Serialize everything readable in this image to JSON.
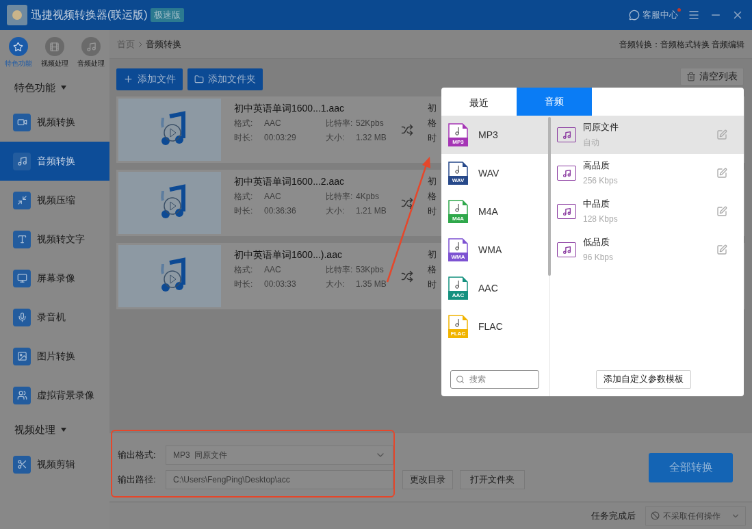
{
  "window": {
    "title": "迅捷视频转换器(联运版)",
    "badge": "极速版",
    "support": "客服中心",
    "has_notification": true
  },
  "nav_tabs": [
    {
      "label": "特色功能",
      "selected": true
    },
    {
      "label": "视频处理",
      "selected": false
    },
    {
      "label": "音频处理",
      "selected": false
    }
  ],
  "sidebar": {
    "sections": [
      {
        "title": "特色功能",
        "expanded": true,
        "items": [
          {
            "label": "视频转换",
            "selected": false
          },
          {
            "label": "音频转换",
            "selected": true
          },
          {
            "label": "视频压缩",
            "selected": false
          },
          {
            "label": "视频转文字",
            "selected": false
          },
          {
            "label": "屏幕录像",
            "selected": false
          },
          {
            "label": "录音机",
            "selected": false
          },
          {
            "label": "图片转换",
            "selected": false
          },
          {
            "label": "虚拟背景录像",
            "selected": false
          }
        ]
      },
      {
        "title": "视频处理",
        "expanded": true,
        "items": [
          {
            "label": "视频剪辑",
            "selected": false
          }
        ]
      }
    ]
  },
  "breadcrumb": [
    "首页",
    "音频转换"
  ],
  "header_links": "音频转换：音频格式转换 音频编辑",
  "toolbar": {
    "add_file": "添加文件",
    "add_folder": "添加文件夹",
    "clear": "清空列表"
  },
  "files": [
    {
      "name": "初中英语单词1600...1.aac",
      "format_label": "格式:",
      "format": "AAC",
      "bitrate_label": "比特率:",
      "bitrate": "52Kpbs",
      "duration_label": "时长:",
      "duration": "00:03:29",
      "size_label": "大小:",
      "size": "1.32 MB",
      "output_partial": [
        "初",
        "格",
        "时"
      ]
    },
    {
      "name": "初中英语单词1600...2.aac",
      "format_label": "格式:",
      "format": "AAC",
      "bitrate_label": "比特率:",
      "bitrate": "4Kpbs",
      "duration_label": "时长:",
      "duration": "00:36:36",
      "size_label": "大小:",
      "size": "1.21 MB",
      "output_partial": [
        "初",
        "格",
        "时"
      ]
    },
    {
      "name": "初中英语单词1600...).aac",
      "format_label": "格式:",
      "format": "AAC",
      "bitrate_label": "比特率:",
      "bitrate": "53Kpbs",
      "duration_label": "时长:",
      "duration": "00:03:33",
      "size_label": "大小:",
      "size": "1.35 MB",
      "output_partial": [
        "初",
        "格",
        "时"
      ]
    }
  ],
  "popup": {
    "tabs": [
      {
        "label": "最近",
        "selected": false
      },
      {
        "label": "音频",
        "selected": true
      }
    ],
    "formats": [
      {
        "label": "MP3",
        "badge": "MP3",
        "color": "#a535b5",
        "selected": true
      },
      {
        "label": "WAV",
        "badge": "WAV",
        "color": "#27498a",
        "selected": false
      },
      {
        "label": "M4A",
        "badge": "M4A",
        "color": "#2fa84b",
        "selected": false
      },
      {
        "label": "WMA",
        "badge": "WMA",
        "color": "#7d52d2",
        "selected": false
      },
      {
        "label": "AAC",
        "badge": "AAC",
        "color": "#15917f",
        "selected": false
      },
      {
        "label": "FLAC",
        "badge": "FLAC",
        "color": "#f1b400",
        "selected": false
      }
    ],
    "search_placeholder": "搜索",
    "presets": [
      {
        "title": "同原文件",
        "detail": "自动",
        "selected": true
      },
      {
        "title": "高品质",
        "detail": "256 Kbps",
        "selected": false
      },
      {
        "title": "中品质",
        "detail": "128 Kbps",
        "selected": false
      },
      {
        "title": "低品质",
        "detail": "96 Kbps",
        "selected": false
      }
    ],
    "add_template": "添加自定义参数模板"
  },
  "output": {
    "format_label": "输出格式:",
    "format_value": "MP3  同原文件",
    "path_label": "输出路径:",
    "path": "C:\\Users\\FengPing\\Desktop\\acc",
    "change_dir": "更改目录",
    "open_folder": "打开文件夹",
    "convert_all": "全部转换"
  },
  "status_bar": {
    "label": "任务完成后",
    "action": "不采取任何操作"
  }
}
